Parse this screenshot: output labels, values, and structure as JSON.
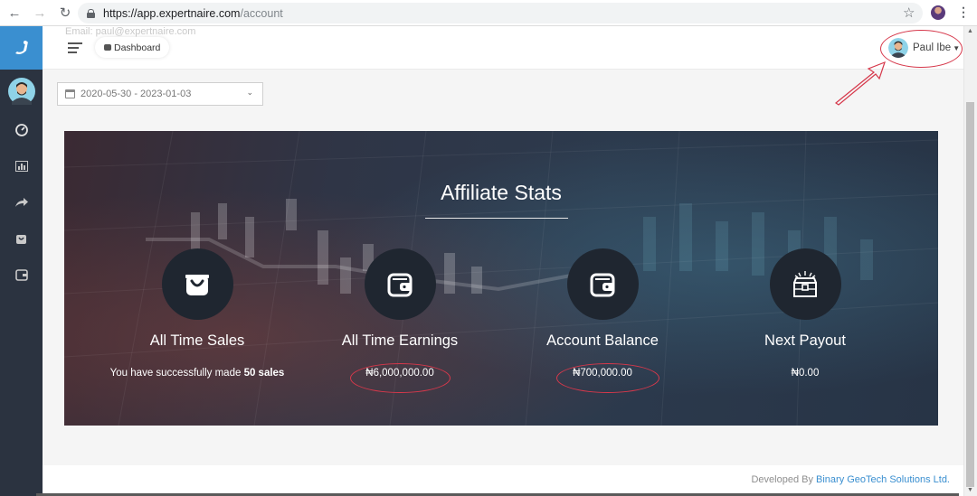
{
  "browser": {
    "url_host": "https://app.expertnaire.com",
    "url_path": "/account"
  },
  "header": {
    "ghost_email": "Email: paul@expertnaire.com",
    "dashboard_label": "Dashboard",
    "user_name": "Paul Ibe"
  },
  "filters": {
    "date_range": "2020-05-30 - 2023-01-03"
  },
  "hero": {
    "title": "Affiliate Stats"
  },
  "stats": [
    {
      "title": "All Time Sales",
      "value_prefix": "You have successfully made ",
      "value_bold": "50 sales",
      "icon": "shopping-bag-icon"
    },
    {
      "title": "All Time Earnings",
      "value": "₦6,000,000.00",
      "icon": "wallet-icon"
    },
    {
      "title": "Account Balance",
      "value": "₦700,000.00",
      "icon": "wallet-icon"
    },
    {
      "title": "Next Payout",
      "value": "₦0.00",
      "icon": "treasure-chest-icon"
    }
  ],
  "footer": {
    "prefix": "Developed By ",
    "company": "Binary GeoTech Solutions Ltd."
  },
  "colors": {
    "sidebar": "#2b3340",
    "accent": "#3a8fd0",
    "annotation": "#d6384b"
  }
}
